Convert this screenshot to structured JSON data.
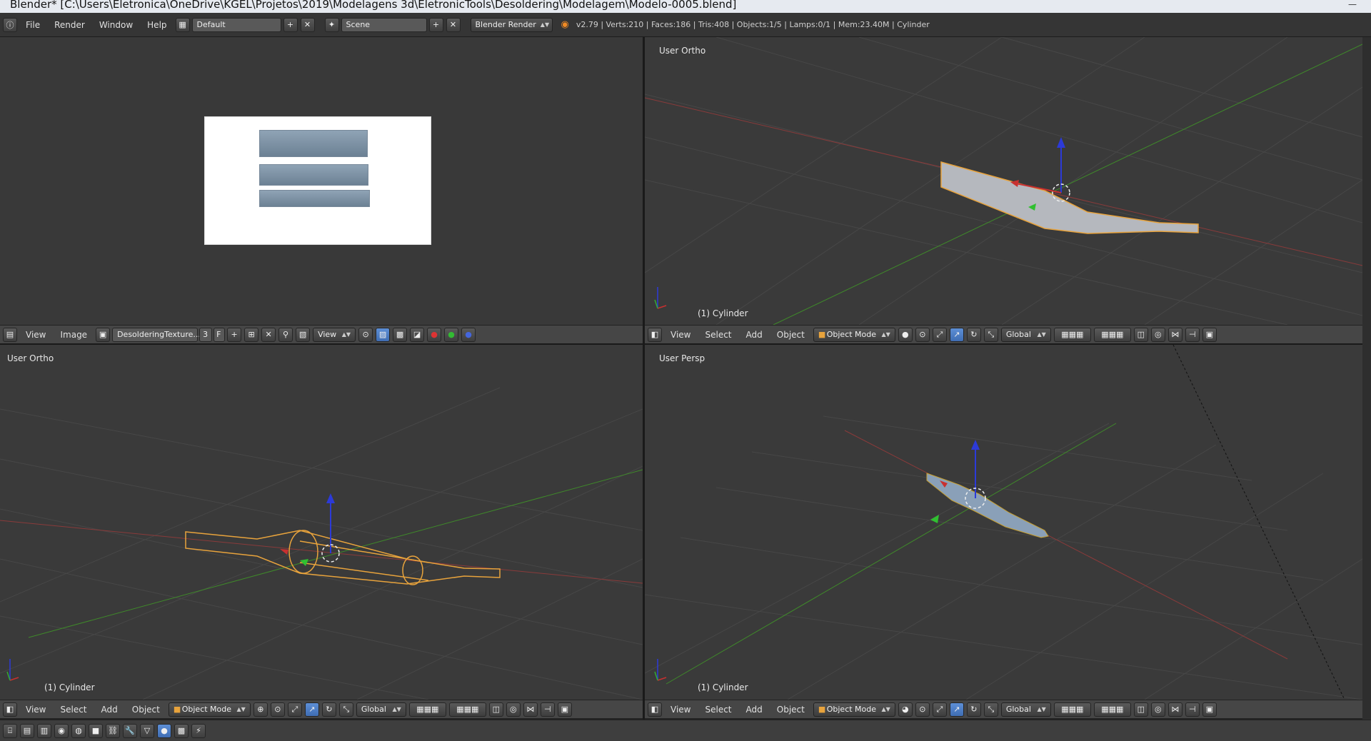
{
  "window": {
    "title": "Blender* [C:\\Users\\Eletronica\\OneDrive\\KGEL\\Projetos\\2019\\Modelagens 3d\\EletronicTools\\Desoldering\\Modelagem\\Modelo-0005.blend]"
  },
  "info_header": {
    "menus": [
      "File",
      "Render",
      "Window",
      "Help"
    ],
    "layout": "Default",
    "scene": "Scene",
    "engine": "Blender Render",
    "stats": "v2.79 | Verts:210 | Faces:186 | Tris:408 | Objects:1/5 | Lamps:0/1 | Mem:23.40M | Cylinder"
  },
  "image_editor": {
    "menus": [
      "View",
      "Image"
    ],
    "image_name": "DesolderingTexture....",
    "users": "3",
    "fake_user": "F",
    "view_mode": "View"
  },
  "viewports": {
    "top_right": {
      "label": "User Ortho",
      "object": "(1) Cylinder"
    },
    "bottom_left": {
      "label": "User Ortho",
      "object": "(1) Cylinder"
    },
    "bottom_right": {
      "label": "User Persp",
      "object": "(1) Cylinder"
    }
  },
  "view3d_header": {
    "menus": [
      "View",
      "Select",
      "Add",
      "Object"
    ],
    "mode": "Object Mode",
    "orientation": "Global"
  },
  "icons": {
    "info": "info-icon",
    "layout": "screen-layout-icon",
    "scene": "scene-icon",
    "blender": "blender-logo-icon",
    "mode": "object-cube-icon",
    "shading": "viewport-shading-icon",
    "pivot": "pivot-point-icon",
    "manipulator": "manipulator-icon",
    "layers": "layers-icon",
    "render": "render-icon"
  },
  "colors": {
    "selection_orange": "#e8a33c",
    "axis_x": "#c84040",
    "axis_y": "#4a9a30",
    "axis_z": "#2c3ad8",
    "viewport_bg": "#3a3a3a"
  }
}
